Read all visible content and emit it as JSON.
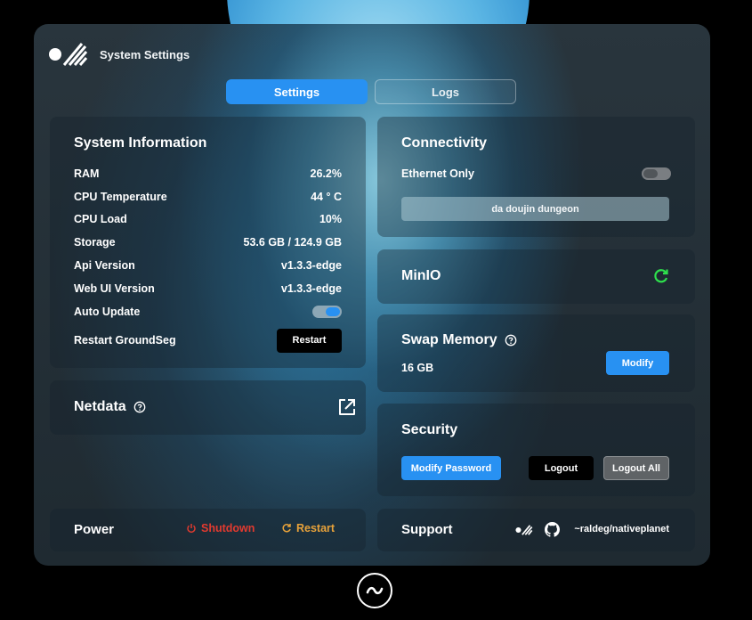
{
  "header": {
    "title": "System Settings"
  },
  "tabs": [
    {
      "label": "Settings",
      "active": true
    },
    {
      "label": "Logs",
      "active": false
    }
  ],
  "system_info": {
    "title": "System Information",
    "rows": [
      {
        "label": "RAM",
        "value": "26.2%"
      },
      {
        "label": "CPU Temperature",
        "value": "44 ° C"
      },
      {
        "label": "CPU Load",
        "value": "10%"
      },
      {
        "label": "Storage",
        "value": "53.6 GB / 124.9 GB"
      },
      {
        "label": "Api Version",
        "value": "v1.3.3-edge"
      },
      {
        "label": "Web UI Version",
        "value": "v1.3.3-edge"
      }
    ],
    "auto_update_label": "Auto Update",
    "auto_update_on": true,
    "restart_label": "Restart GroundSeg",
    "restart_button": "Restart"
  },
  "netdata": {
    "title": "Netdata"
  },
  "power": {
    "title": "Power",
    "shutdown_label": "Shutdown",
    "restart_label": "Restart"
  },
  "connectivity": {
    "title": "Connectivity",
    "ethernet_label": "Ethernet Only",
    "ethernet_on": false,
    "network_name": "da doujin dungeon"
  },
  "minio": {
    "title": "MinIO"
  },
  "swap": {
    "title": "Swap Memory",
    "value": "16 GB",
    "modify_button": "Modify"
  },
  "security": {
    "title": "Security",
    "modify_password_button": "Modify Password",
    "logout_button": "Logout",
    "logout_all_button": "Logout All"
  },
  "support": {
    "title": "Support",
    "repo_link": "~raldeg/nativeplanet"
  },
  "colors": {
    "accent": "#2891f2",
    "danger": "#e23a2f",
    "warning": "#e8a23a",
    "success": "#2ee04d"
  },
  "icons": {
    "logo": "nativeplanet-logo-icon",
    "help": "help-circle-icon",
    "external": "external-link-icon",
    "refresh": "refresh-icon",
    "power": "power-icon",
    "github": "github-icon",
    "home": "tilde-home-icon"
  }
}
